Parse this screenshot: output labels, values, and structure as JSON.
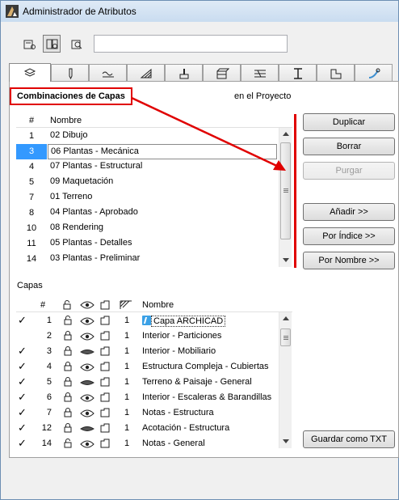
{
  "window": {
    "title": "Administrador de Atributos"
  },
  "toolbar": {
    "search_value": "",
    "view_buttons": [
      "list-view-icon",
      "list-search-view-icon",
      "search-view-icon"
    ]
  },
  "tabs": [
    {
      "icon": "layers-icon",
      "selected": true
    },
    {
      "icon": "pen-icon",
      "selected": false
    },
    {
      "icon": "line-type-icon",
      "selected": false
    },
    {
      "icon": "fill-icon",
      "selected": false
    },
    {
      "icon": "material-brush-icon",
      "selected": false
    },
    {
      "icon": "composite-icon",
      "selected": false
    },
    {
      "icon": "surface-pattern-icon",
      "selected": false
    },
    {
      "icon": "profile-icon",
      "selected": false
    },
    {
      "icon": "zone-category-icon",
      "selected": false
    },
    {
      "icon": "mep-system-icon",
      "selected": false
    }
  ],
  "combinations": {
    "title": "Combinaciones de Capas",
    "scope_label": "en el Proyecto",
    "headers": {
      "num": "#",
      "name": "Nombre"
    },
    "rows": [
      {
        "num": "1",
        "name": "02 Dibujo"
      },
      {
        "num": "3",
        "name": "06 Plantas - Mecánica"
      },
      {
        "num": "4",
        "name": "07 Plantas - Estructural"
      },
      {
        "num": "5",
        "name": "09 Maquetación"
      },
      {
        "num": "7",
        "name": "01 Terreno"
      },
      {
        "num": "8",
        "name": "04 Plantas - Aprobado"
      },
      {
        "num": "10",
        "name": "08 Rendering"
      },
      {
        "num": "11",
        "name": "05 Plantas - Detalles"
      },
      {
        "num": "14",
        "name": "03 Plantas - Preliminar"
      }
    ],
    "selected_index": 1
  },
  "buttons": {
    "duplicar": "Duplicar",
    "borrar": "Borrar",
    "purgar": "Purgar",
    "anadir": "Añadir >>",
    "por_indice": "Por Índice >>",
    "por_nombre": "Por Nombre >>",
    "guardar_txt": "Guardar como TXT"
  },
  "layers": {
    "title": "Capas",
    "headers": {
      "num": "#",
      "name": "Nombre"
    },
    "rows": [
      {
        "check": "✓",
        "num": "1",
        "lock": "unlocked",
        "eye": "open",
        "wire": "1",
        "name": "Capa ARCHICAD",
        "archicad": true
      },
      {
        "check": "",
        "num": "2",
        "lock": "locked",
        "eye": "open",
        "wire": "1",
        "name": "Interior - Particiones"
      },
      {
        "check": "✓",
        "num": "3",
        "lock": "locked",
        "eye": "closed",
        "wire": "1",
        "name": "Interior - Mobiliario"
      },
      {
        "check": "✓",
        "num": "4",
        "lock": "locked",
        "eye": "open",
        "wire": "1",
        "name": "Estructura Compleja - Cubiertas"
      },
      {
        "check": "✓",
        "num": "5",
        "lock": "locked",
        "eye": "closed",
        "wire": "1",
        "name": "Terreno & Paisaje - General"
      },
      {
        "check": "✓",
        "num": "6",
        "lock": "locked",
        "eye": "open",
        "wire": "1",
        "name": "Interior - Escaleras & Barandillas"
      },
      {
        "check": "✓",
        "num": "7",
        "lock": "locked",
        "eye": "open",
        "wire": "1",
        "name": "Notas - Estructura"
      },
      {
        "check": "✓",
        "num": "12",
        "lock": "locked",
        "eye": "closed",
        "wire": "1",
        "name": "Acotación - Estructura"
      },
      {
        "check": "✓",
        "num": "14",
        "lock": "unlocked",
        "eye": "open",
        "wire": "1",
        "name": "Notas - General"
      }
    ]
  },
  "colors": {
    "annotation_red": "#e00000",
    "selection_blue": "#3399ff",
    "archicad_blue": "#3ba1e6"
  }
}
